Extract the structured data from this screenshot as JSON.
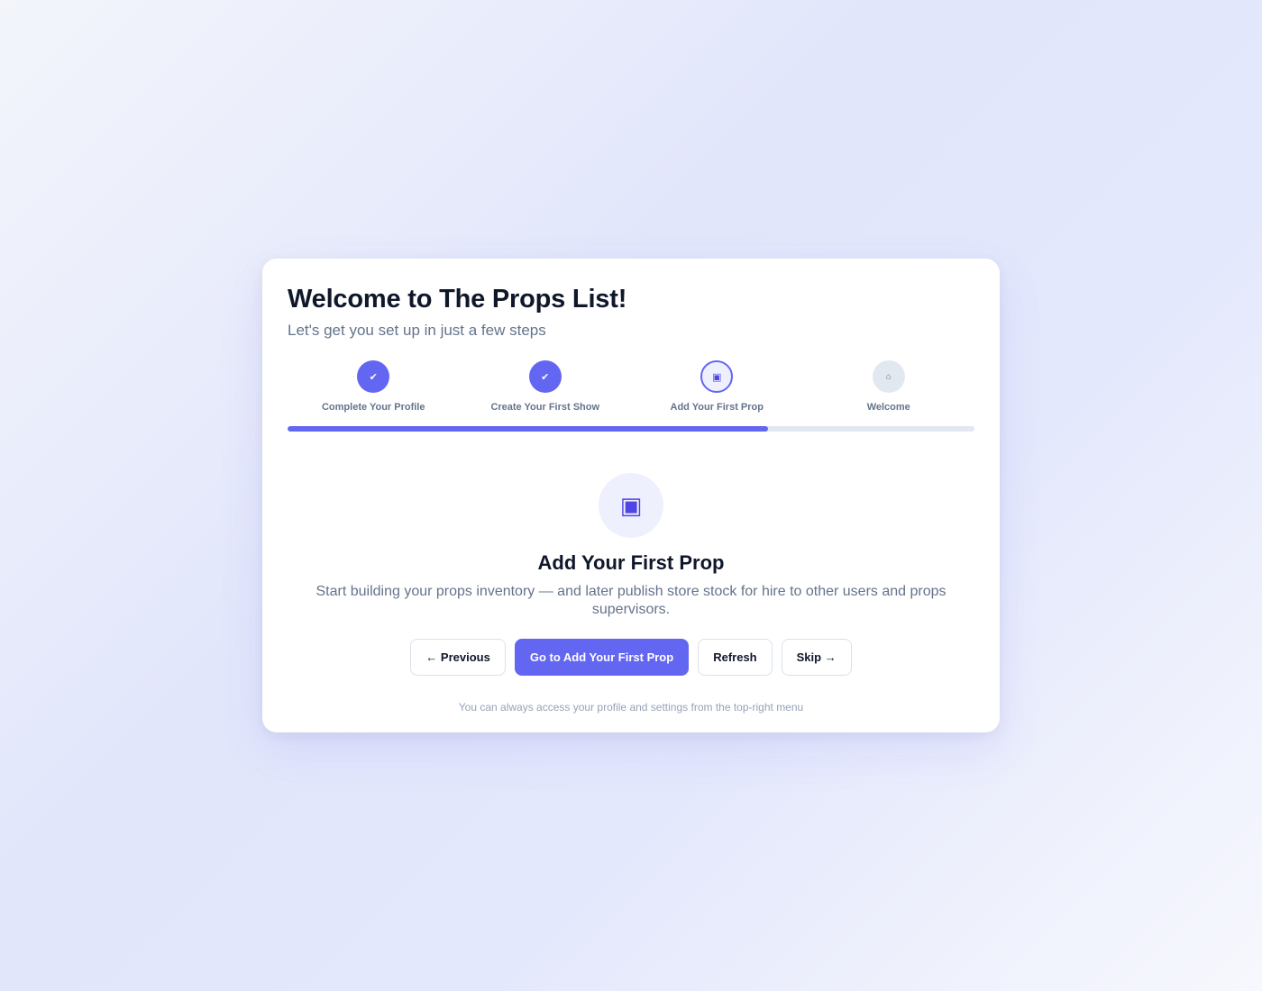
{
  "header": {
    "title": "Welcome to The Props List!",
    "subtitle": "Let's get you set up in just a few steps"
  },
  "steps": [
    {
      "label": "Complete Your Profile",
      "status": "done",
      "icon": "check-icon",
      "glyph": "✔"
    },
    {
      "label": "Create Your First Show",
      "status": "done",
      "icon": "check-icon",
      "glyph": "✔"
    },
    {
      "label": "Add Your First Prop",
      "status": "active",
      "icon": "box-icon",
      "glyph": "▣"
    },
    {
      "label": "Welcome",
      "status": "pending",
      "icon": "home-icon",
      "glyph": "⌂"
    }
  ],
  "progress": {
    "percent": 70
  },
  "current_step": {
    "icon": "box-icon",
    "glyph": "▣",
    "title": "Add Your First Prop",
    "description": "Start building your props inventory — and later publish store stock for hire to other users and props supervisors."
  },
  "actions": {
    "previous_label": "← Previous",
    "primary_label": "Go to Add Your First Prop",
    "refresh_label": "Refresh",
    "skip_label": "Skip →"
  },
  "footnote": "You can always access your profile and settings from the top-right menu",
  "colors": {
    "accent": "#6366f1",
    "title": "#0f172a",
    "muted": "#64748b"
  }
}
